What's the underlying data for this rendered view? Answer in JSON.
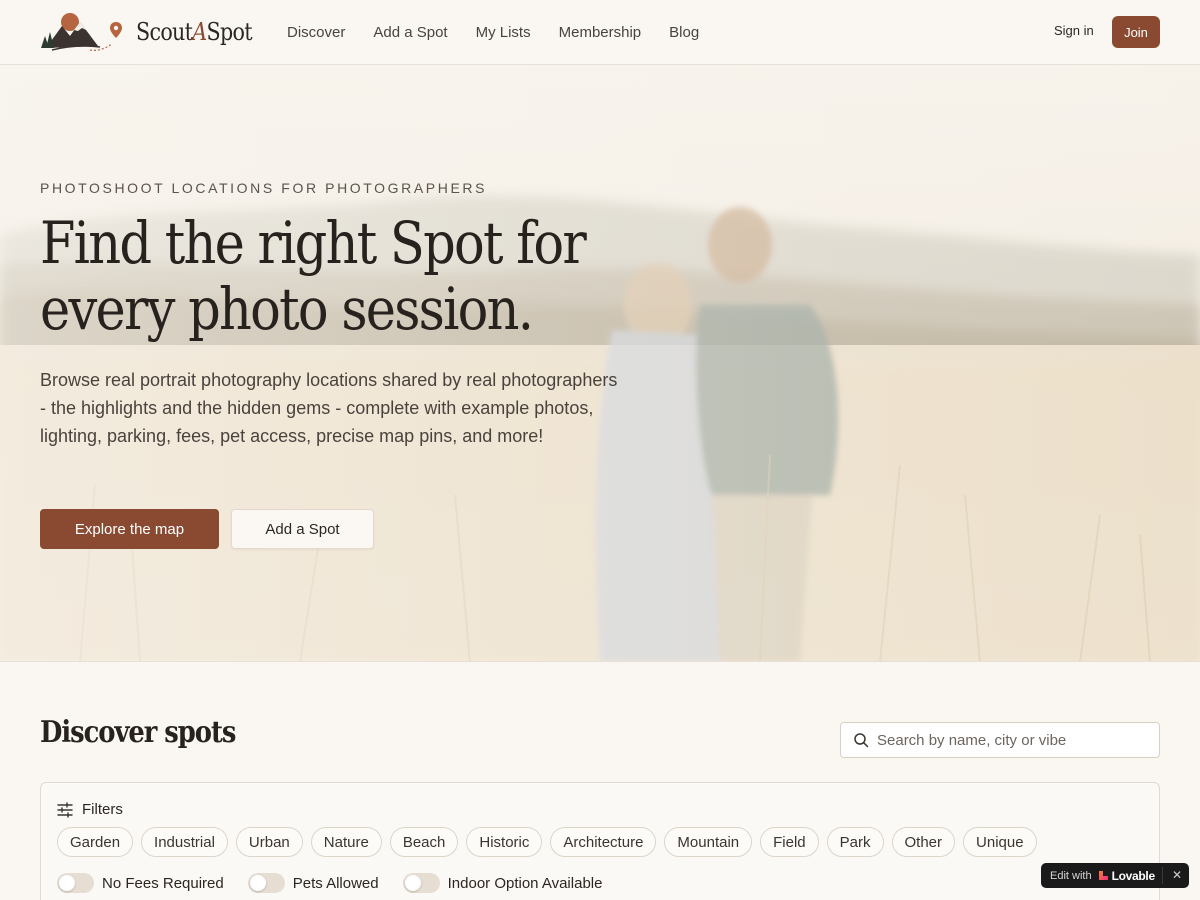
{
  "header": {
    "logo": {
      "prefix": "Scout",
      "accent": "A",
      "suffix": "Spot"
    },
    "nav": [
      "Discover",
      "Add a Spot",
      "My Lists",
      "Membership",
      "Blog"
    ],
    "sign_in": "Sign in",
    "join": "Join"
  },
  "hero": {
    "eyebrow": "PHOTOSHOOT LOCATIONS FOR PHOTOGRAPHERS",
    "headline": "Find the right Spot for every photo session.",
    "lede": "Browse real portrait photography locations shared by real photographers - the highlights and the hidden gems - complete with example photos, lighting, parking, fees, pet access, precise map pins, and more!",
    "primary_cta": "Explore the map",
    "secondary_cta": "Add a Spot"
  },
  "discover": {
    "title": "Discover spots",
    "search_placeholder": "Search by name, city or vibe",
    "filters_label": "Filters",
    "categories": [
      "Garden",
      "Industrial",
      "Urban",
      "Nature",
      "Beach",
      "Historic",
      "Architecture",
      "Mountain",
      "Field",
      "Park",
      "Other",
      "Unique"
    ],
    "toggles": [
      {
        "label": "No Fees Required",
        "on": false
      },
      {
        "label": "Pets Allowed",
        "on": false
      },
      {
        "label": "Indoor Option Available",
        "on": false
      }
    ]
  },
  "badge": {
    "edit_text": "Edit with",
    "brand": "Lovable",
    "close": "✕"
  },
  "colors": {
    "accent": "#8a4a32",
    "background": "#faf7f2",
    "text": "#2b2622"
  }
}
